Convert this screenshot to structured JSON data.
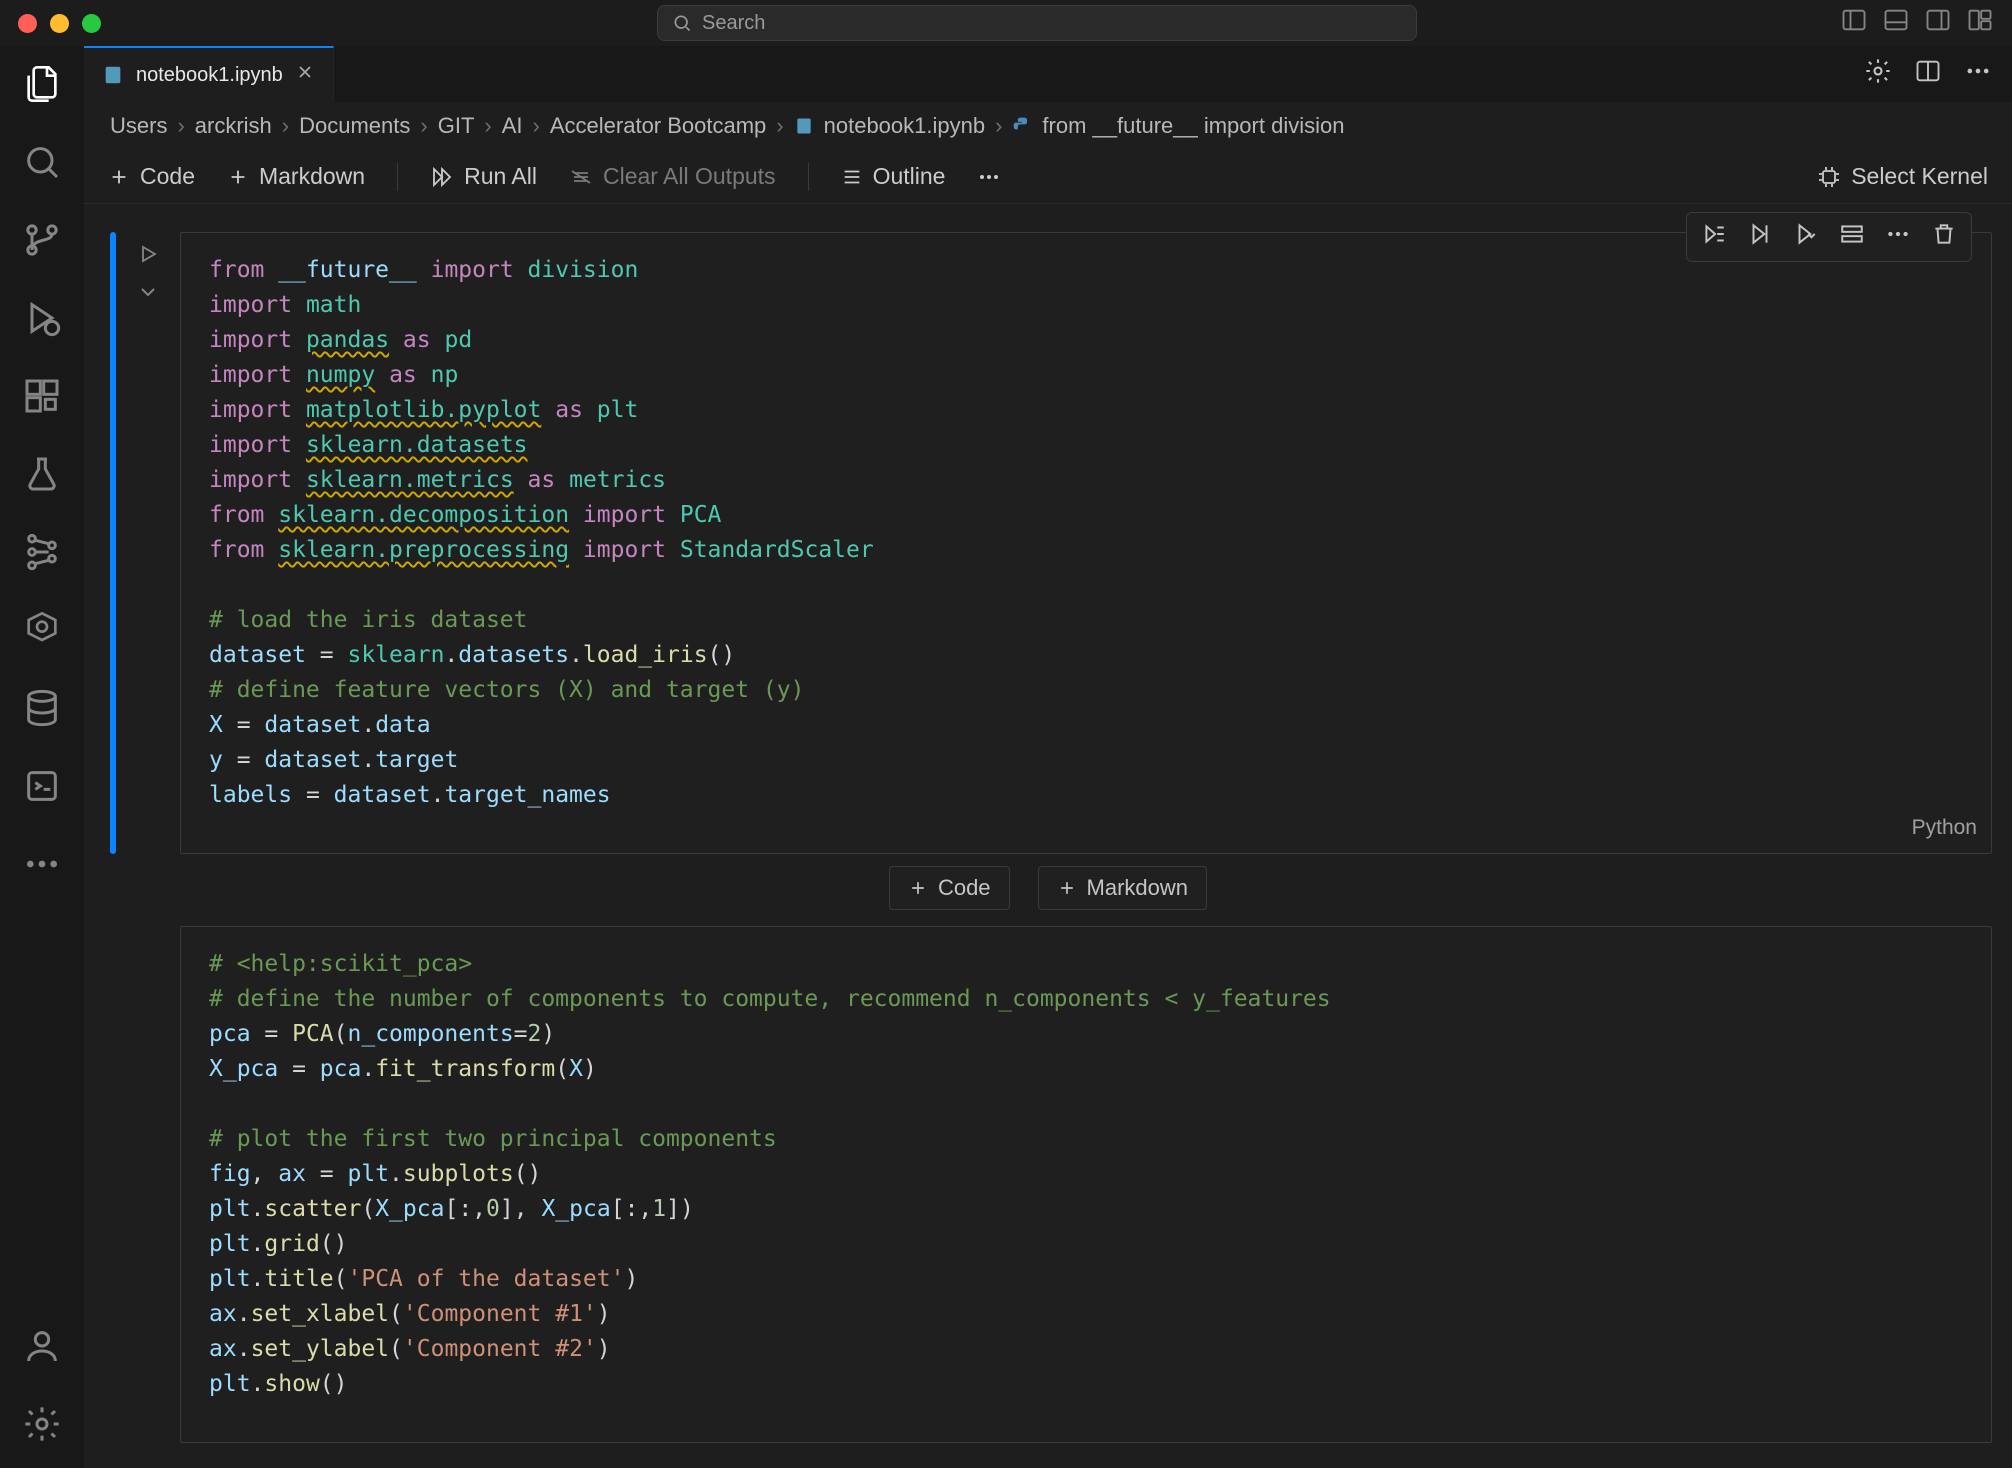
{
  "titlebar": {
    "search_placeholder": "Search"
  },
  "tab": {
    "filename": "notebook1.ipynb"
  },
  "breadcrumbs": {
    "parts": [
      "Users",
      "arckrish",
      "Documents",
      "GIT",
      "AI",
      "Accelerator Bootcamp"
    ],
    "file": "notebook1.ipynb",
    "symbol": "from __future__ import division"
  },
  "toolbar": {
    "code": "Code",
    "markdown": "Markdown",
    "run_all": "Run All",
    "clear_outputs": "Clear All Outputs",
    "outline": "Outline",
    "select_kernel": "Select Kernel"
  },
  "add_cell": {
    "code": "Code",
    "markdown": "Markdown"
  },
  "cell1": {
    "language_label": "Python",
    "tokens": {
      "from": "from",
      "import": "import",
      "as_": "as",
      "future": "__future__",
      "division": "division",
      "math": "math",
      "pandas": "pandas",
      "pd": "pd",
      "numpy": "numpy",
      "np": "np",
      "matplotlib_pyplot": "matplotlib.pyplot",
      "plt": "plt",
      "sklearn_datasets": "sklearn.datasets",
      "sklearn_metrics": "sklearn.metrics",
      "metrics": "metrics",
      "sklearn_decomposition": "sklearn.decomposition",
      "PCA": "PCA",
      "sklearn_preprocessing": "sklearn.preprocessing",
      "StandardScaler": "StandardScaler",
      "c_load_iris": "# load the iris dataset",
      "dataset": "dataset",
      "eq": " = ",
      "sklearn": "sklearn",
      "dot": ".",
      "datasets": "datasets",
      "load_iris": "load_iris",
      "parens": "()",
      "c_define": "# define feature vectors (X) and target (y)",
      "X": "X",
      "data": "data",
      "y": "y",
      "target": "target",
      "labels": "labels",
      "target_names": "target_names"
    }
  },
  "cell2": {
    "tokens": {
      "c_help": "# <help:scikit_pca>",
      "c_define_comp": "# define the number of components to compute, recommend n_components < y_features",
      "pca": "pca",
      "eq": " = ",
      "PCA": "PCA",
      "lparen": "(",
      "n_components_kw": "n_components",
      "assign": "=",
      "two": "2",
      "rparen": ")",
      "X_pca": "X_pca",
      "dot": ".",
      "fit_transform": "fit_transform",
      "X": "X",
      "c_plot": "# plot the first two principal components",
      "fig": "fig",
      "comma_sp": ", ",
      "ax": "ax",
      "plt": "plt",
      "subplots": "subplots",
      "parens": "()",
      "scatter": "scatter",
      "lbrack": "[",
      "colon": ":",
      "comma": ",",
      "zero": "0",
      "rbrack": "]",
      "one": "1",
      "grid": "grid",
      "title": "title",
      "s_title": "'PCA of the dataset'",
      "set_xlabel": "set_xlabel",
      "s_c1": "'Component #1'",
      "set_ylabel": "set_ylabel",
      "s_c2": "'Component #2'",
      "show": "show"
    }
  }
}
